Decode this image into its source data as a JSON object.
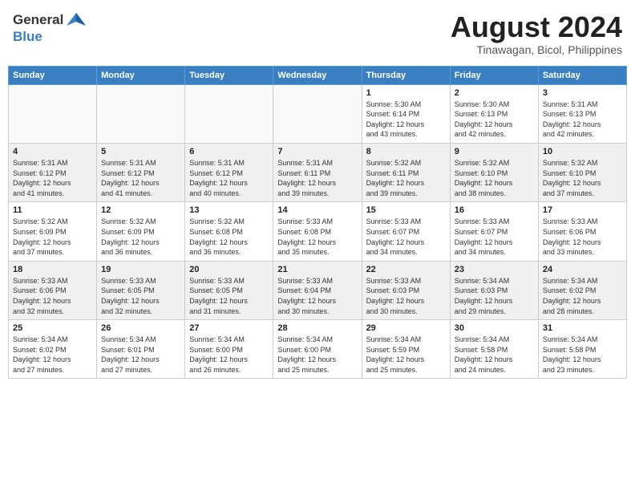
{
  "header": {
    "logo_general": "General",
    "logo_blue": "Blue",
    "month_title": "August 2024",
    "location": "Tinawagan, Bicol, Philippines"
  },
  "days_of_week": [
    "Sunday",
    "Monday",
    "Tuesday",
    "Wednesday",
    "Thursday",
    "Friday",
    "Saturday"
  ],
  "weeks": [
    [
      {
        "day": "",
        "info": ""
      },
      {
        "day": "",
        "info": ""
      },
      {
        "day": "",
        "info": ""
      },
      {
        "day": "",
        "info": ""
      },
      {
        "day": "1",
        "info": "Sunrise: 5:30 AM\nSunset: 6:14 PM\nDaylight: 12 hours\nand 43 minutes."
      },
      {
        "day": "2",
        "info": "Sunrise: 5:30 AM\nSunset: 6:13 PM\nDaylight: 12 hours\nand 42 minutes."
      },
      {
        "day": "3",
        "info": "Sunrise: 5:31 AM\nSunset: 6:13 PM\nDaylight: 12 hours\nand 42 minutes."
      }
    ],
    [
      {
        "day": "4",
        "info": "Sunrise: 5:31 AM\nSunset: 6:12 PM\nDaylight: 12 hours\nand 41 minutes."
      },
      {
        "day": "5",
        "info": "Sunrise: 5:31 AM\nSunset: 6:12 PM\nDaylight: 12 hours\nand 41 minutes."
      },
      {
        "day": "6",
        "info": "Sunrise: 5:31 AM\nSunset: 6:12 PM\nDaylight: 12 hours\nand 40 minutes."
      },
      {
        "day": "7",
        "info": "Sunrise: 5:31 AM\nSunset: 6:11 PM\nDaylight: 12 hours\nand 39 minutes."
      },
      {
        "day": "8",
        "info": "Sunrise: 5:32 AM\nSunset: 6:11 PM\nDaylight: 12 hours\nand 39 minutes."
      },
      {
        "day": "9",
        "info": "Sunrise: 5:32 AM\nSunset: 6:10 PM\nDaylight: 12 hours\nand 38 minutes."
      },
      {
        "day": "10",
        "info": "Sunrise: 5:32 AM\nSunset: 6:10 PM\nDaylight: 12 hours\nand 37 minutes."
      }
    ],
    [
      {
        "day": "11",
        "info": "Sunrise: 5:32 AM\nSunset: 6:09 PM\nDaylight: 12 hours\nand 37 minutes."
      },
      {
        "day": "12",
        "info": "Sunrise: 5:32 AM\nSunset: 6:09 PM\nDaylight: 12 hours\nand 36 minutes."
      },
      {
        "day": "13",
        "info": "Sunrise: 5:32 AM\nSunset: 6:08 PM\nDaylight: 12 hours\nand 36 minutes."
      },
      {
        "day": "14",
        "info": "Sunrise: 5:33 AM\nSunset: 6:08 PM\nDaylight: 12 hours\nand 35 minutes."
      },
      {
        "day": "15",
        "info": "Sunrise: 5:33 AM\nSunset: 6:07 PM\nDaylight: 12 hours\nand 34 minutes."
      },
      {
        "day": "16",
        "info": "Sunrise: 5:33 AM\nSunset: 6:07 PM\nDaylight: 12 hours\nand 34 minutes."
      },
      {
        "day": "17",
        "info": "Sunrise: 5:33 AM\nSunset: 6:06 PM\nDaylight: 12 hours\nand 33 minutes."
      }
    ],
    [
      {
        "day": "18",
        "info": "Sunrise: 5:33 AM\nSunset: 6:06 PM\nDaylight: 12 hours\nand 32 minutes."
      },
      {
        "day": "19",
        "info": "Sunrise: 5:33 AM\nSunset: 6:05 PM\nDaylight: 12 hours\nand 32 minutes."
      },
      {
        "day": "20",
        "info": "Sunrise: 5:33 AM\nSunset: 6:05 PM\nDaylight: 12 hours\nand 31 minutes."
      },
      {
        "day": "21",
        "info": "Sunrise: 5:33 AM\nSunset: 6:04 PM\nDaylight: 12 hours\nand 30 minutes."
      },
      {
        "day": "22",
        "info": "Sunrise: 5:33 AM\nSunset: 6:03 PM\nDaylight: 12 hours\nand 30 minutes."
      },
      {
        "day": "23",
        "info": "Sunrise: 5:34 AM\nSunset: 6:03 PM\nDaylight: 12 hours\nand 29 minutes."
      },
      {
        "day": "24",
        "info": "Sunrise: 5:34 AM\nSunset: 6:02 PM\nDaylight: 12 hours\nand 28 minutes."
      }
    ],
    [
      {
        "day": "25",
        "info": "Sunrise: 5:34 AM\nSunset: 6:02 PM\nDaylight: 12 hours\nand 27 minutes."
      },
      {
        "day": "26",
        "info": "Sunrise: 5:34 AM\nSunset: 6:01 PM\nDaylight: 12 hours\nand 27 minutes."
      },
      {
        "day": "27",
        "info": "Sunrise: 5:34 AM\nSunset: 6:00 PM\nDaylight: 12 hours\nand 26 minutes."
      },
      {
        "day": "28",
        "info": "Sunrise: 5:34 AM\nSunset: 6:00 PM\nDaylight: 12 hours\nand 25 minutes."
      },
      {
        "day": "29",
        "info": "Sunrise: 5:34 AM\nSunset: 5:59 PM\nDaylight: 12 hours\nand 25 minutes."
      },
      {
        "day": "30",
        "info": "Sunrise: 5:34 AM\nSunset: 5:58 PM\nDaylight: 12 hours\nand 24 minutes."
      },
      {
        "day": "31",
        "info": "Sunrise: 5:34 AM\nSunset: 5:58 PM\nDaylight: 12 hours\nand 23 minutes."
      }
    ]
  ]
}
